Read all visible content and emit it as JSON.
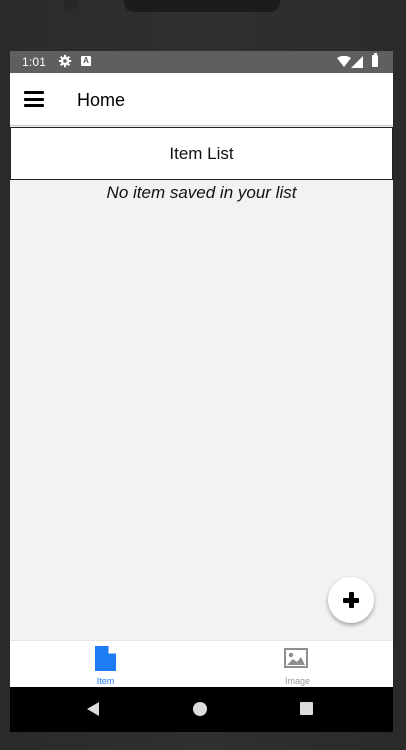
{
  "status_bar": {
    "time": "1:01",
    "icons": [
      "gear-icon",
      "a-notification-icon",
      "wifi-icon",
      "signal-icon",
      "battery-icon"
    ],
    "notification_letter": "A"
  },
  "header": {
    "title": "Home",
    "menu_icon": "hamburger-menu-icon"
  },
  "main": {
    "list_title": "Item List",
    "empty_message": "No item saved in your list"
  },
  "fab": {
    "icon": "plus-icon"
  },
  "tabs": [
    {
      "label": "Item",
      "icon": "document-icon",
      "active": true
    },
    {
      "label": "Image",
      "icon": "image-icon",
      "active": false
    }
  ],
  "nav": {
    "icons": [
      "back-icon",
      "home-icon",
      "recents-icon"
    ]
  },
  "colors": {
    "accent": "#1e7cf2",
    "inactive_tab": "#9a9a9a",
    "status_bar": "#5f5f5f",
    "background": "#f2f2f2"
  }
}
